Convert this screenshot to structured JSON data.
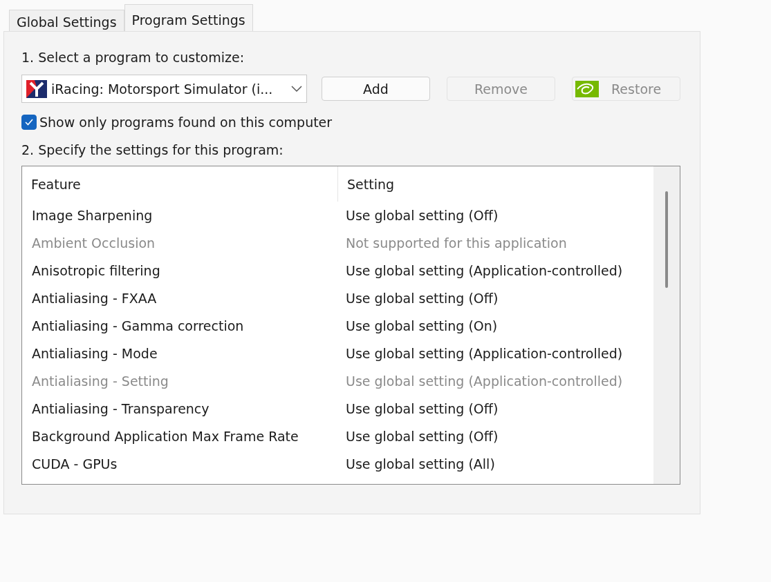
{
  "tabs": [
    {
      "label": "Global Settings",
      "selected": false
    },
    {
      "label": "Program Settings",
      "selected": true
    }
  ],
  "step1_label": "1. Select a program to customize:",
  "program_select": {
    "value": "iRacing: Motorsport Simulator (i..."
  },
  "buttons": [
    {
      "label": "Add",
      "disabled": false,
      "kind": "plain"
    },
    {
      "label": "Remove",
      "disabled": true,
      "kind": "plain"
    },
    {
      "label": "Restore",
      "disabled": true,
      "kind": "logo"
    }
  ],
  "show_only_checkbox": {
    "label": "Show only programs found on this computer",
    "checked": true
  },
  "step2_label": "2. Specify the settings for this program:",
  "table": {
    "columns": [
      "Feature",
      "Setting"
    ],
    "rows": [
      {
        "feature": "Image Sharpening",
        "setting": "Use global setting (Off)",
        "disabled": false
      },
      {
        "feature": "Ambient Occlusion",
        "setting": "Not supported for this application",
        "disabled": true
      },
      {
        "feature": "Anisotropic filtering",
        "setting": "Use global setting (Application-controlled)",
        "disabled": false
      },
      {
        "feature": "Antialiasing - FXAA",
        "setting": "Use global setting (Off)",
        "disabled": false
      },
      {
        "feature": "Antialiasing - Gamma correction",
        "setting": "Use global setting (On)",
        "disabled": false
      },
      {
        "feature": "Antialiasing - Mode",
        "setting": "Use global setting (Application-controlled)",
        "disabled": false
      },
      {
        "feature": "Antialiasing - Setting",
        "setting": "Use global setting (Application-controlled)",
        "disabled": true
      },
      {
        "feature": "Antialiasing - Transparency",
        "setting": "Use global setting (Off)",
        "disabled": false
      },
      {
        "feature": "Background Application Max Frame Rate",
        "setting": "Use global setting (Off)",
        "disabled": false
      },
      {
        "feature": "CUDA - GPUs",
        "setting": "Use global setting (All)",
        "disabled": false
      }
    ]
  }
}
